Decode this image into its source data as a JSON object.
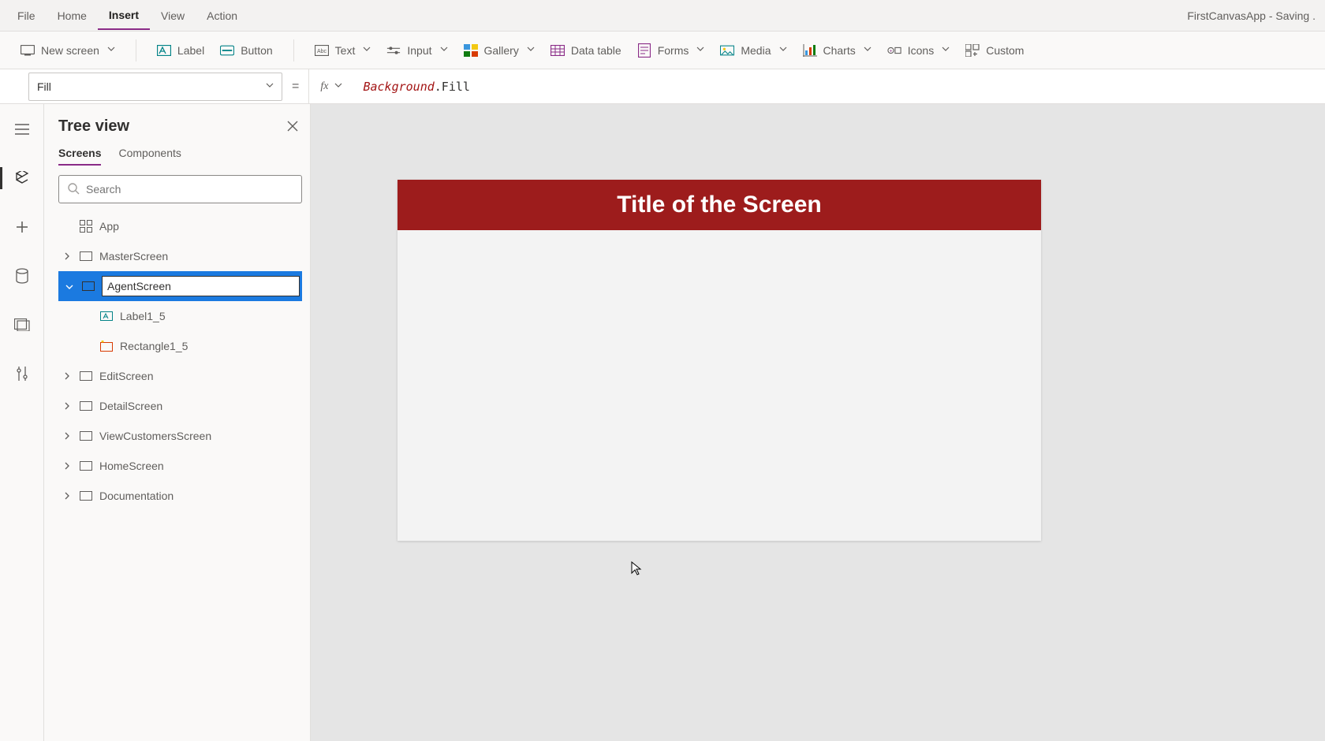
{
  "app_header": {
    "title_status": "FirstCanvasApp - Saving ."
  },
  "menus": {
    "file": "File",
    "home": "Home",
    "insert": "Insert",
    "view": "View",
    "action": "Action"
  },
  "ribbon": {
    "new_screen": "New screen",
    "label": "Label",
    "button": "Button",
    "text": "Text",
    "input": "Input",
    "gallery": "Gallery",
    "data_table": "Data table",
    "forms": "Forms",
    "media": "Media",
    "charts": "Charts",
    "icons": "Icons",
    "custom": "Custom"
  },
  "formula": {
    "property": "Fill",
    "token1": "Background",
    "token2": ".Fill"
  },
  "tree": {
    "title": "Tree view",
    "tab_screens": "Screens",
    "tab_components": "Components",
    "search_placeholder": "Search",
    "app": "App",
    "screens": {
      "master": "MasterScreen",
      "agent_edit_value": "AgentScreen",
      "label1_5": "Label1_5",
      "rectangle1_5": "Rectangle1_5",
      "edit": "EditScreen",
      "detail": "DetailScreen",
      "view_customers": "ViewCustomersScreen",
      "home": "HomeScreen",
      "documentation": "Documentation"
    }
  },
  "canvas": {
    "title": "Title of the Screen"
  }
}
